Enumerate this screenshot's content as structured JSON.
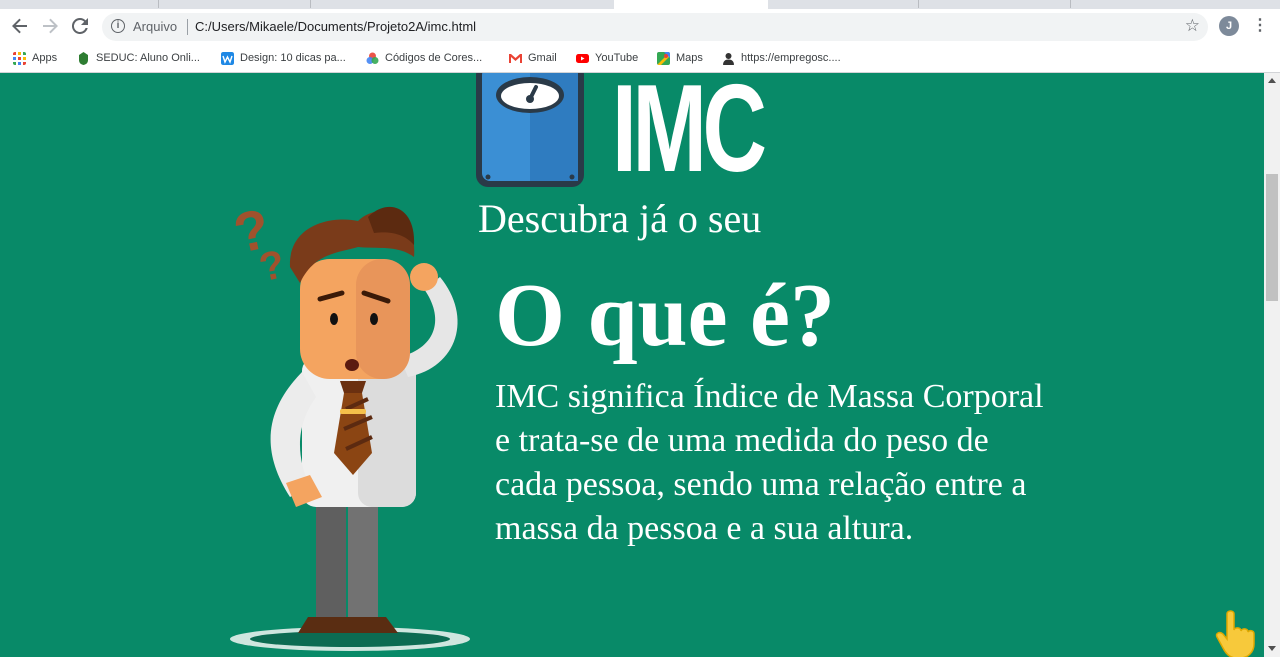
{
  "browser": {
    "address": {
      "security_chip": "Arquivo",
      "url": "C:/Users/Mikaele/Documents/Projeto2A/imc.html"
    },
    "profile_initial": "J",
    "bookmarks": [
      {
        "label": "Apps",
        "icon": "apps-grid-icon",
        "color": "#ea4335"
      },
      {
        "label": "SEDUC: Aluno Onli...",
        "icon": "seduc-icon",
        "color": "#2e7d32"
      },
      {
        "label": "Design: 10 dicas pa...",
        "icon": "design-site-icon",
        "color": "#1e88e5"
      },
      {
        "label": "Códigos de Cores...",
        "icon": "color-wheel-icon",
        "color": "#fbbc05"
      },
      {
        "label": "Gmail",
        "icon": "gmail-icon",
        "color": "#ea4335"
      },
      {
        "label": "YouTube",
        "icon": "youtube-icon",
        "color": "#ff0000"
      },
      {
        "label": "Maps",
        "icon": "maps-icon",
        "color": "#34a853"
      },
      {
        "label": "https://empregosc....",
        "icon": "empregos-site-icon",
        "color": "#333333"
      }
    ]
  },
  "page": {
    "logo_text": "IMC",
    "subtitle": "Descubra já o seu",
    "heading": "O que é?",
    "paragraph": "IMC significa Índice de Massa Corporal e trata-se de uma medida do peso de cada pessoa, sendo uma relação entre a massa da pessoa e a sua altura.",
    "background_color": "#088a68",
    "text_color": "#ffffff"
  }
}
